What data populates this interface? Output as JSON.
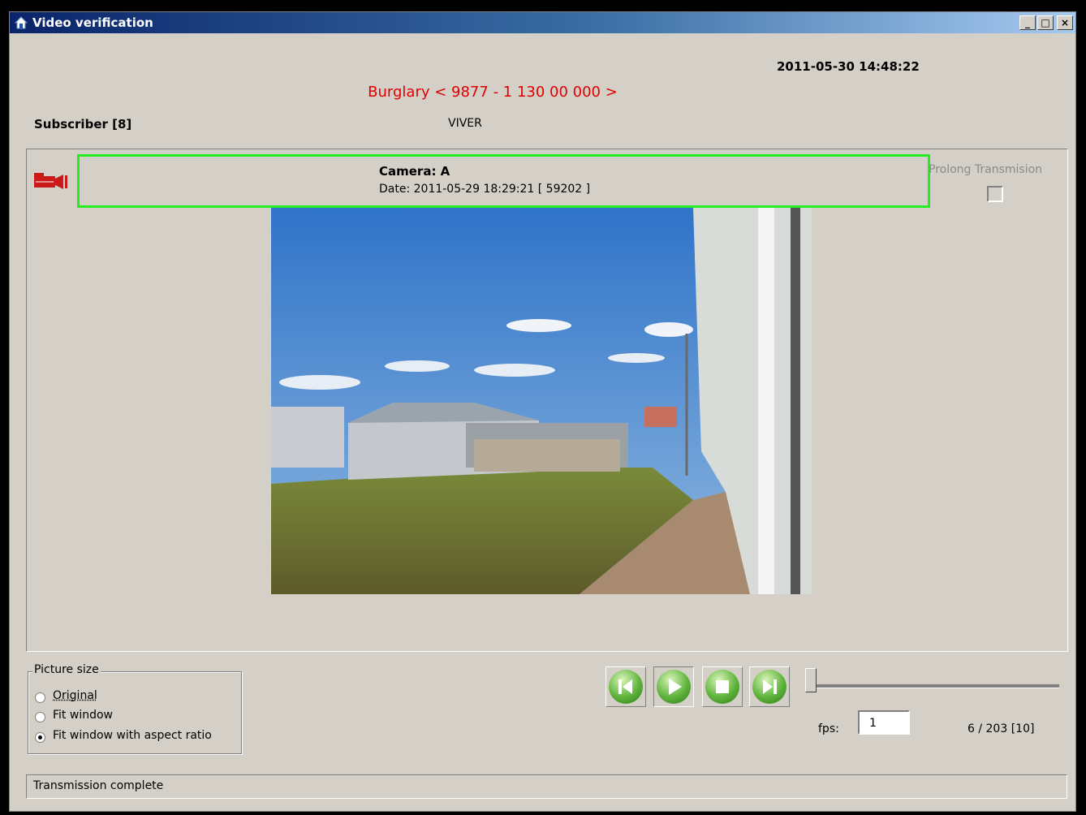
{
  "window": {
    "title": "Video verification",
    "minimize_symbol": "_",
    "maximize_symbol": "□",
    "close_symbol": "×"
  },
  "header": {
    "datetime": "2011-05-30 14:48:22",
    "alarm": "Burglary < 9877 - 1 130 00 000 >",
    "subscriber_label": "Subscriber [8]",
    "subscriber_name": "VIVER"
  },
  "camera": {
    "name": "Camera: A",
    "date": "Date: 2011-05-29 18:29:21 [ 59202 ]",
    "prolong_label": "Prolong Transmision",
    "prolong_checked": false
  },
  "picture_size": {
    "label": "Picture size",
    "options": [
      "Original",
      "Fit window",
      "Fit window with aspect ratio"
    ],
    "selected": "Fit window with aspect ratio"
  },
  "playback": {
    "buttons": [
      "previous-frame",
      "play",
      "stop",
      "next-frame"
    ],
    "fps_label": "fps:",
    "fps_value": "1",
    "counter": "6 / 203 [10]",
    "position_fraction": 0.0
  },
  "status": {
    "text": "Transmission complete"
  },
  "colors": {
    "alarm": "#e00000",
    "highlight": "#22ee22",
    "camera_icon": "#cc1a1a",
    "button_green": "#5fb43c"
  }
}
